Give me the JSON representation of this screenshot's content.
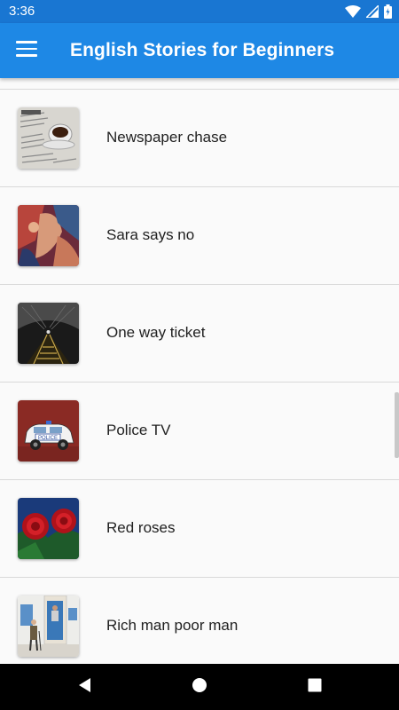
{
  "status_bar": {
    "time": "3:36",
    "icons": [
      "wifi-icon",
      "signal-icon",
      "battery-icon"
    ]
  },
  "app_bar": {
    "title": "English Stories for Beginners",
    "menu_icon": "hamburger-menu-icon"
  },
  "stories": [
    {
      "title": "Newspaper chase",
      "thumbnail": "newspaper-coffee-image"
    },
    {
      "title": "Sara says no",
      "thumbnail": "painting-image"
    },
    {
      "title": "One way ticket",
      "thumbnail": "railway-tunnel-image"
    },
    {
      "title": "Police TV",
      "thumbnail": "police-car-image"
    },
    {
      "title": "Red roses",
      "thumbnail": "red-roses-image"
    },
    {
      "title": "Rich man poor man",
      "thumbnail": "old-man-street-image"
    }
  ],
  "nav_bar": {
    "buttons": [
      "back-icon",
      "home-icon",
      "recents-icon"
    ]
  },
  "colors": {
    "status_bar": "#1976d2",
    "app_bar": "#1e88e5",
    "background": "#fafafa"
  }
}
